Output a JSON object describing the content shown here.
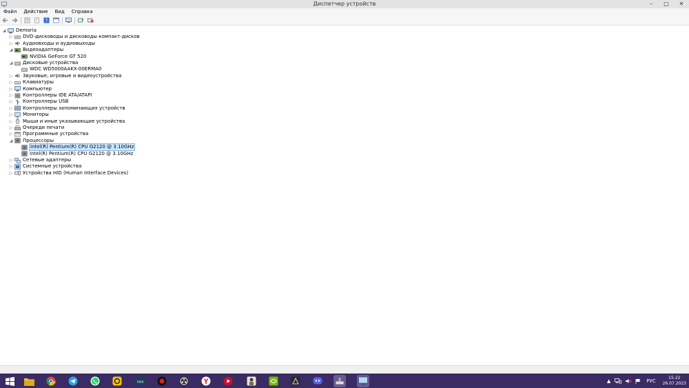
{
  "window": {
    "title": "Диспетчер устройств",
    "controls": [
      "–",
      "□",
      "✕"
    ]
  },
  "menu": [
    "Файл",
    "Действие",
    "Вид",
    "Справка"
  ],
  "toolbar_icons": [
    "back-icon",
    "forward-icon",
    "properties-icon",
    "list-icon",
    "help-icon",
    "view-icon",
    "display-icon",
    "update-driver-icon",
    "uninstall-icon"
  ],
  "tree": [
    {
      "label": "Demoria",
      "depth": 0,
      "expanded": true,
      "icon": "computer-icon"
    },
    {
      "label": "DVD-дисководы и дисководы компакт-дисков",
      "depth": 1,
      "expanded": false,
      "icon": "dvd-icon"
    },
    {
      "label": "Аудиовходы и аудиовыходы",
      "depth": 1,
      "expanded": false,
      "icon": "audio-icon"
    },
    {
      "label": "Видеоадаптеры",
      "depth": 1,
      "expanded": true,
      "icon": "display-adapter-icon"
    },
    {
      "label": "NVIDIA GeForce GT 520",
      "depth": 2,
      "icon": "display-adapter-icon"
    },
    {
      "label": "Дисковые устройства",
      "depth": 1,
      "expanded": true,
      "icon": "disk-icon"
    },
    {
      "label": "WDC WD5000AAKX-00ERMA0",
      "depth": 2,
      "icon": "disk-icon"
    },
    {
      "label": "Звуковые, игровые и видеоустройства",
      "depth": 1,
      "expanded": false,
      "icon": "sound-icon"
    },
    {
      "label": "Клавиатуры",
      "depth": 1,
      "expanded": false,
      "icon": "keyboard-icon"
    },
    {
      "label": "Компьютер",
      "depth": 1,
      "expanded": false,
      "icon": "computer-icon"
    },
    {
      "label": "Контроллеры IDE ATA/ATAPI",
      "depth": 1,
      "expanded": false,
      "icon": "ide-icon"
    },
    {
      "label": "Контроллеры USB",
      "depth": 1,
      "expanded": false,
      "icon": "usb-icon"
    },
    {
      "label": "Контроллеры запоминающих устройств",
      "depth": 1,
      "expanded": false,
      "icon": "storage-icon"
    },
    {
      "label": "Мониторы",
      "depth": 1,
      "expanded": false,
      "icon": "monitor-icon"
    },
    {
      "label": "Мыши и иные указывающие устройства",
      "depth": 1,
      "expanded": false,
      "icon": "mouse-icon"
    },
    {
      "label": "Очереди печати",
      "depth": 1,
      "expanded": false,
      "icon": "printer-icon"
    },
    {
      "label": "Программные устройства",
      "depth": 1,
      "expanded": false,
      "icon": "software-device-icon"
    },
    {
      "label": "Процессоры",
      "depth": 1,
      "expanded": true,
      "icon": "cpu-icon"
    },
    {
      "label": "Intel(R) Pentium(R) CPU G2120 @ 3.10GHz",
      "depth": 2,
      "icon": "cpu-icon",
      "selected": true
    },
    {
      "label": "Intel(R) Pentium(R) CPU G2120 @ 3.10GHz",
      "depth": 2,
      "icon": "cpu-icon"
    },
    {
      "label": "Сетевые адаптеры",
      "depth": 1,
      "expanded": false,
      "icon": "network-icon"
    },
    {
      "label": "Системные устройства",
      "depth": 1,
      "expanded": false,
      "icon": "system-icon"
    },
    {
      "label": "Устройства HID (Human Interface Devices)",
      "depth": 1,
      "expanded": false,
      "icon": "hid-icon"
    }
  ],
  "taskbar": {
    "apps": [
      {
        "name": "start-icon"
      },
      {
        "name": "file-explorer-icon"
      },
      {
        "name": "chrome-icon"
      },
      {
        "name": "telegram-icon"
      },
      {
        "name": "whatsapp-icon"
      },
      {
        "name": "app-d-icon"
      },
      {
        "name": "nox-icon"
      },
      {
        "name": "record-icon"
      },
      {
        "name": "obs-icon"
      },
      {
        "name": "yandex-icon"
      },
      {
        "name": "video-icon"
      },
      {
        "name": "character-app-icon"
      },
      {
        "name": "nvidia-icon"
      },
      {
        "name": "game-icon"
      },
      {
        "name": "discord-icon"
      },
      {
        "name": "device-manager-icon"
      },
      {
        "name": "network-app-icon"
      }
    ],
    "tray": {
      "language": "РУС",
      "time": "15:22",
      "date": "26.07.2023"
    }
  }
}
